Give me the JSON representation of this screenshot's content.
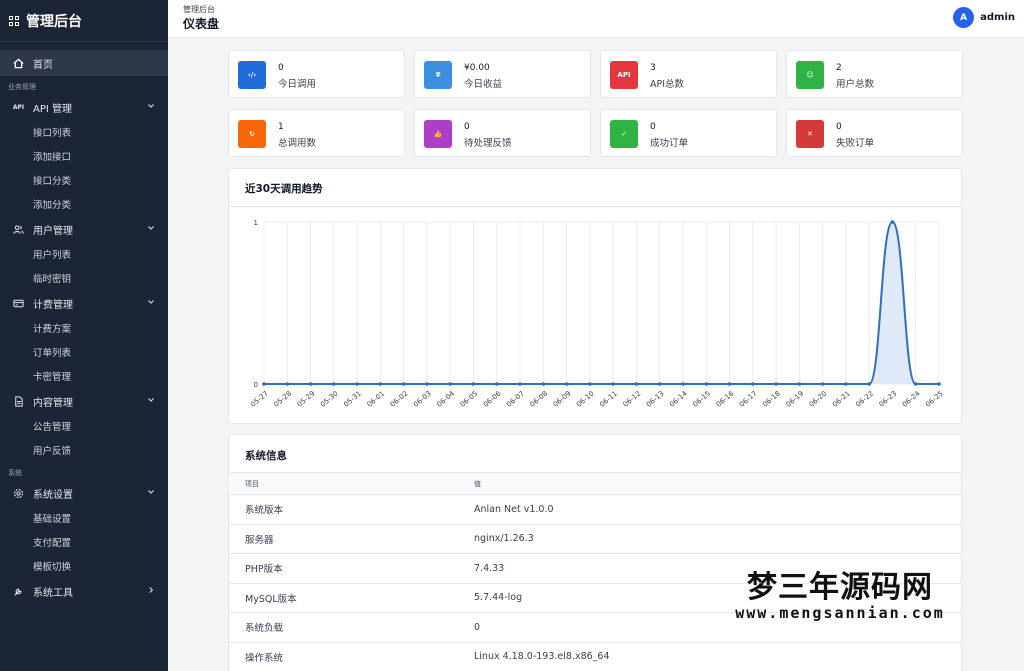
{
  "brand": {
    "title": "管理后台"
  },
  "header": {
    "breadcrumb": "管理后台",
    "title": "仪表盘",
    "avatar_letter": "A",
    "username": "admin"
  },
  "sidebar": {
    "home": "首页",
    "section_business": "业务管理",
    "groups": [
      {
        "label": "API 管理",
        "icon": "api-icon",
        "items": [
          "接口列表",
          "添加接口",
          "接口分类",
          "添加分类"
        ]
      },
      {
        "label": "用户管理",
        "icon": "users-icon",
        "items": [
          "用户列表",
          "临时密钥"
        ]
      },
      {
        "label": "计费管理",
        "icon": "billing-icon",
        "items": [
          "计费方案",
          "订单列表",
          "卡密管理"
        ]
      },
      {
        "label": "内容管理",
        "icon": "document-icon",
        "items": [
          "公告管理",
          "用户反馈"
        ]
      }
    ],
    "section_system": "系统",
    "system_groups": [
      {
        "label": "系统设置",
        "icon": "gear-icon",
        "items": [
          "基础设置",
          "支付配置",
          "模板切换"
        ]
      },
      {
        "label": "系统工具",
        "icon": "wrench-icon",
        "items": []
      }
    ]
  },
  "stats": [
    {
      "value": "0",
      "label": "今日调用",
      "color": "#1f6bd8",
      "icon": "code-icon",
      "glyph": "‹/›"
    },
    {
      "value": "¥0.00",
      "label": "今日收益",
      "color": "#3b8fe0",
      "icon": "yen-icon",
      "glyph": "¥"
    },
    {
      "value": "3",
      "label": "API总数",
      "color": "#e0383e",
      "icon": "api-icon",
      "glyph": "API"
    },
    {
      "value": "2",
      "label": "用户总数",
      "color": "#2fb344",
      "icon": "users-icon",
      "glyph": "☺"
    },
    {
      "value": "1",
      "label": "总调用数",
      "color": "#f76707",
      "icon": "refresh-icon",
      "glyph": "↻"
    },
    {
      "value": "0",
      "label": "待处理反馈",
      "color": "#ae3ec9",
      "icon": "thumb-icon",
      "glyph": "👍"
    },
    {
      "value": "0",
      "label": "成功订单",
      "color": "#2fb344",
      "icon": "check-icon",
      "glyph": "✓"
    },
    {
      "value": "0",
      "label": "失败订单",
      "color": "#d63939",
      "icon": "x-icon",
      "glyph": "✕"
    }
  ],
  "trend": {
    "title": "近30天调用趋势"
  },
  "chart_data": {
    "type": "area",
    "title": "",
    "xlabel": "",
    "ylabel": "",
    "categories": [
      "05-27",
      "05-28",
      "05-29",
      "05-30",
      "05-31",
      "06-01",
      "06-02",
      "06-03",
      "06-04",
      "06-05",
      "06-06",
      "06-07",
      "06-08",
      "06-09",
      "06-10",
      "06-11",
      "06-12",
      "06-13",
      "06-14",
      "06-15",
      "06-16",
      "06-17",
      "06-18",
      "06-19",
      "06-20",
      "06-21",
      "06-22",
      "06-23",
      "06-24",
      "06-25"
    ],
    "values": [
      0,
      0,
      0,
      0,
      0,
      0,
      0,
      0,
      0,
      0,
      0,
      0,
      0,
      0,
      0,
      0,
      0,
      0,
      0,
      0,
      0,
      0,
      0,
      0,
      0,
      0,
      0,
      1,
      0,
      0
    ],
    "ylim": [
      0,
      1
    ],
    "yticks": [
      "0",
      "1"
    ],
    "grid": true,
    "line_color": "#2f6fc0",
    "fill_color": "#dbe7f6"
  },
  "sysinfo": {
    "title": "系统信息",
    "col_item": "项目",
    "col_value": "值",
    "rows": [
      {
        "k": "系统版本",
        "v": "Anlan Net v1.0.0"
      },
      {
        "k": "服务器",
        "v": "nginx/1.26.3"
      },
      {
        "k": "PHP版本",
        "v": "7.4.33"
      },
      {
        "k": "MySQL版本",
        "v": "5.7.44-log"
      },
      {
        "k": "系统负载",
        "v": "0"
      },
      {
        "k": "操作系统",
        "v": "Linux 4.18.0-193.el8.x86_64"
      }
    ]
  },
  "watermark": {
    "big": "梦三年源码网",
    "small": "www.mengsannian.com"
  }
}
